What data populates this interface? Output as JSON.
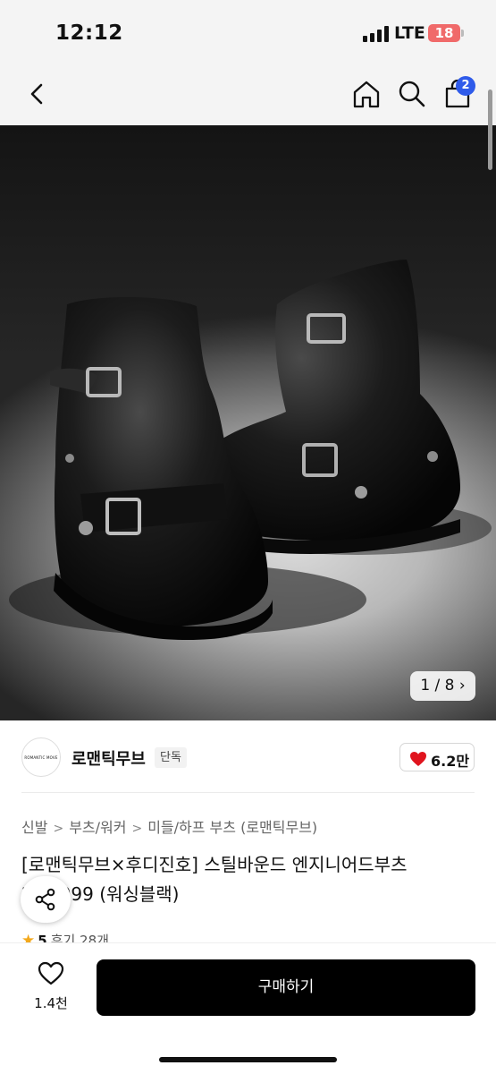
{
  "status_bar": {
    "time": "12:12",
    "network": "LTE",
    "battery": "18"
  },
  "nav": {
    "cart_count": "2",
    "icons": [
      "back-icon",
      "home-icon",
      "search-icon",
      "cart-icon"
    ]
  },
  "gallery": {
    "counter": "1 / 8 ›"
  },
  "brand": {
    "name": "로맨틱무브",
    "logo_text": "ROMANTIC MOVE",
    "tag": "단독",
    "likes": "6.2만"
  },
  "product": {
    "breadcrumb": [
      "신발",
      "부츠/워커",
      "미들/하프 부츠 (로맨틱무브)"
    ],
    "title": "[로맨틱무브×후디진호] 스틸바운드 엔지니어드부츠 24M999 (워싱블랙)",
    "rating": "5",
    "reviews": "후기 28개"
  },
  "bottom_bar": {
    "wish_count": "1.4천",
    "buy_label": "구매하기"
  },
  "colors": {
    "badge": "#2f5bea",
    "heart": "#e0141e",
    "star": "#f3a81b",
    "buy_button": "#000000"
  }
}
